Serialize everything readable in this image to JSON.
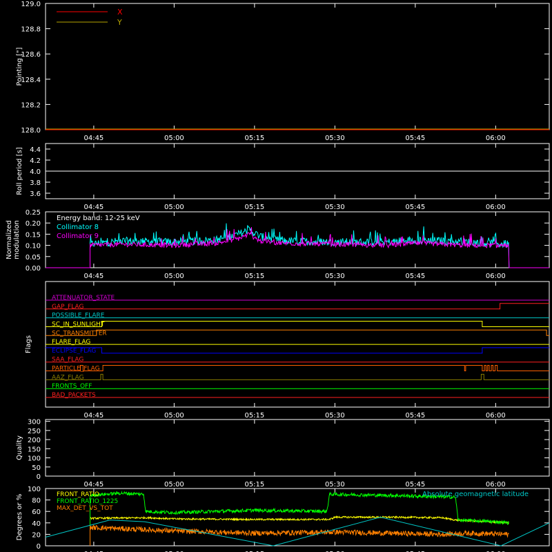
{
  "figure": {
    "background": "#000000",
    "axis_color": "#ffffff",
    "time_ticks": [
      "04:45",
      "05:00",
      "05:15",
      "05:30",
      "05:45",
      "06:00"
    ],
    "time_tick_minutes": [
      285,
      300,
      315,
      330,
      345,
      360
    ],
    "time_range_minutes": [
      276,
      370
    ]
  },
  "chart_data": [
    {
      "id": "pointing",
      "type": "line",
      "ylabel": "Pointing [\"]",
      "ylim": [
        128.0,
        129.0
      ],
      "yticks": [
        "128.0",
        "128.2",
        "128.4",
        "128.6",
        "128.8",
        "129.0"
      ],
      "ytick_values": [
        128.0,
        128.2,
        128.4,
        128.6,
        128.8,
        129.0
      ],
      "series": [
        {
          "name": "X",
          "color": "#ff0000",
          "x": [
            276,
            370
          ],
          "y": [
            128.0,
            128.0
          ]
        },
        {
          "name": "Y",
          "color": "#b8a600",
          "x": [
            276,
            370
          ],
          "y": [
            128.0,
            128.0
          ]
        }
      ]
    },
    {
      "id": "roll",
      "type": "line",
      "ylabel": "Roll period [s]",
      "ylim": [
        3.5,
        4.5
      ],
      "yticks": [
        "3.6",
        "3.8",
        "4.0",
        "4.2",
        "4.4"
      ],
      "ytick_values": [
        3.6,
        3.8,
        4.0,
        4.2,
        4.4
      ],
      "series": [
        {
          "name": "",
          "color": "#ffffff",
          "x": [
            276,
            370
          ],
          "y": [
            4.0,
            4.0
          ]
        }
      ]
    },
    {
      "id": "modulation",
      "type": "line",
      "ylabel": "Normalized modulation",
      "ylabel_lines": [
        "Normalized",
        "modulation"
      ],
      "ylim": [
        0.0,
        0.25
      ],
      "yticks": [
        "0.00",
        "0.05",
        "0.10",
        "0.15",
        "0.20",
        "0.25"
      ],
      "ytick_values": [
        0.0,
        0.05,
        0.1,
        0.15,
        0.2,
        0.25
      ],
      "annotation": "Energy band: 12-25 keV",
      "data_span": [
        284.3,
        362.5
      ],
      "series": [
        {
          "name": "Collimator 8",
          "color": "#00ffff",
          "x": [
            276,
            284.3,
            290,
            300,
            308,
            312,
            314,
            316,
            320,
            330,
            340,
            345,
            350,
            355,
            362.5,
            370
          ],
          "y": [
            0.0,
            0.105,
            0.12,
            0.115,
            0.125,
            0.15,
            0.17,
            0.14,
            0.12,
            0.115,
            0.115,
            0.125,
            0.12,
            0.115,
            0.105,
            0.0
          ]
        },
        {
          "name": "Collimator 9",
          "color": "#ff00ff",
          "x": [
            276,
            284.3,
            290,
            300,
            308,
            312,
            314,
            316,
            320,
            330,
            340,
            345,
            350,
            355,
            362.5,
            370
          ],
          "y": [
            0.0,
            0.1,
            0.105,
            0.1,
            0.11,
            0.13,
            0.15,
            0.12,
            0.11,
            0.105,
            0.1,
            0.11,
            0.105,
            0.1,
            0.1,
            0.0
          ]
        }
      ]
    },
    {
      "id": "flags",
      "type": "line",
      "ylabel": "Flags",
      "flags": [
        {
          "name": "ATTENUATOR_STATE",
          "color": "#d000d0",
          "steps": []
        },
        {
          "name": "GAP_FLAG",
          "color": "#ff2020",
          "steps": [
            [
              360.8,
              1
            ]
          ]
        },
        {
          "name": "POSSIBLE_FLARE",
          "color": "#00c8c8",
          "steps": []
        },
        {
          "name": "SC_IN_SUNLIGHT",
          "color": "#ffff00",
          "steps": [
            [
              276,
              0
            ],
            [
              286.5,
              1
            ],
            [
              357.5,
              0
            ]
          ]
        },
        {
          "name": "SC_TRANSMITTER",
          "color": "#ff8000",
          "steps": [
            [
              276,
              0
            ],
            [
              285.5,
              1
            ],
            [
              369.5,
              0
            ]
          ]
        },
        {
          "name": "FLARE_FLAG",
          "color": "#ffff00",
          "steps": []
        },
        {
          "name": "ECLIPSE_FLAG",
          "color": "#0000ff",
          "steps": [
            [
              276,
              1
            ],
            [
              286.5,
              0
            ],
            [
              357.5,
              1
            ]
          ]
        },
        {
          "name": "SAA_FLAG",
          "color": "#ff2020",
          "steps": []
        },
        {
          "name": "PARTICLE_FLAG",
          "color": "#ff6000",
          "steps": [
            [
              282.5,
              1
            ],
            [
              283,
              0
            ],
            [
              286.7,
              1
            ],
            [
              354.2,
              0
            ],
            [
              354.4,
              1
            ],
            [
              357.5,
              0
            ],
            [
              357.9,
              1
            ],
            [
              358.2,
              0
            ],
            [
              358.5,
              1
            ],
            [
              358.8,
              0
            ],
            [
              359.2,
              1
            ],
            [
              359.5,
              0
            ],
            [
              359.9,
              1
            ],
            [
              360.3,
              0
            ]
          ]
        },
        {
          "name": "AAZ_FLAG",
          "color": "#8b7d00",
          "steps": [
            [
              286.3,
              1
            ],
            [
              286.7,
              0
            ],
            [
              357.3,
              1
            ],
            [
              357.8,
              0
            ]
          ]
        },
        {
          "name": "FRONTS_OFF",
          "color": "#00ff00",
          "steps": []
        },
        {
          "name": "BAD_PACKETS",
          "color": "#ff2020",
          "steps": []
        }
      ]
    },
    {
      "id": "quality",
      "type": "line",
      "ylabel": "Quality",
      "ylim": [
        0,
        310
      ],
      "yticks": [
        "0",
        "50",
        "100",
        "150",
        "200",
        "250",
        "300"
      ],
      "ytick_values": [
        0,
        50,
        100,
        150,
        200,
        250,
        300
      ],
      "series": []
    },
    {
      "id": "ratios",
      "type": "line",
      "ylabel": "Degrees or %",
      "ylim": [
        0,
        100
      ],
      "yticks": [
        "0",
        "20",
        "40",
        "60",
        "80",
        "100"
      ],
      "ytick_values": [
        0,
        20,
        40,
        60,
        80,
        100
      ],
      "legend_right": "Absolute geomagnetic latitude",
      "series": [
        {
          "name": "FRONT_RATIO",
          "color": "#ffff00",
          "x": [
            284.3,
            295,
            300,
            315,
            329,
            330,
            340,
            350,
            352.5,
            362.5
          ],
          "y": [
            48,
            49,
            47,
            46,
            46,
            50,
            50,
            49,
            45,
            40
          ]
        },
        {
          "name": "FRONT_RATIO_1225",
          "color": "#00ff00",
          "x": [
            284.3,
            290,
            294.3,
            294.7,
            300,
            315,
            328.5,
            329,
            340,
            352.5,
            353,
            360,
            362.5
          ],
          "y": [
            88,
            92,
            90,
            60,
            58,
            62,
            60,
            90,
            88,
            85,
            45,
            42,
            40
          ]
        },
        {
          "name": "MAX_DET_VS_TOT",
          "color": "#ff8000",
          "x": [
            284.3,
            290,
            300,
            315,
            330,
            340,
            350,
            355,
            362.5
          ],
          "y": [
            32,
            30,
            26,
            22,
            24,
            22,
            20,
            22,
            20
          ]
        },
        {
          "name": "Absolute geomagnetic latitude",
          "color": "#00c8c8",
          "x": [
            276,
            288,
            294.5,
            318.5,
            338.5,
            361,
            370
          ],
          "y": [
            15,
            45,
            42,
            0,
            50,
            0,
            40
          ]
        }
      ]
    }
  ]
}
